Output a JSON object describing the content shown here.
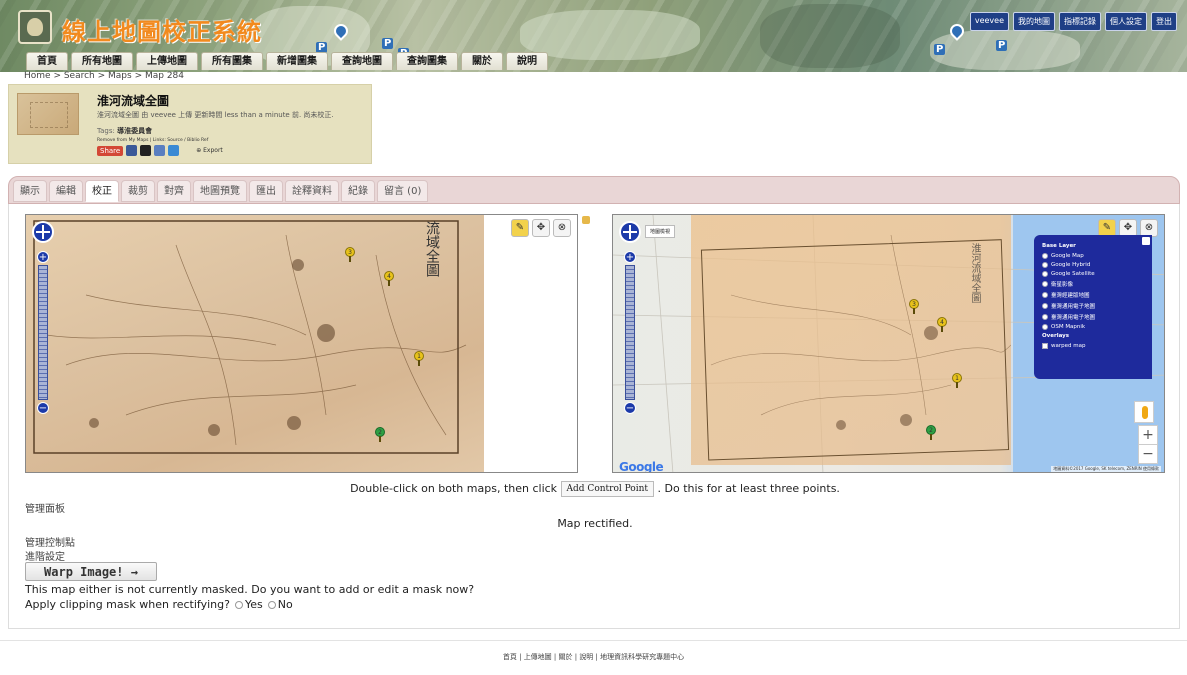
{
  "site": {
    "title": "線上地圖校正系統",
    "user_links": [
      "veevee",
      "我的地圖",
      "指標記錄",
      "個人設定",
      "登出"
    ]
  },
  "nav": {
    "items": [
      "首頁",
      "所有地圖",
      "上傳地圖",
      "所有圖集",
      "新增圖集",
      "查詢地圖",
      "查詢圖集",
      "關於",
      "說明"
    ]
  },
  "breadcrumb": "Home > Search > Maps > Map 284",
  "map_info": {
    "title": "淮河流域全圖",
    "description": "淮河流域全圖 由 veevee 上傳 更新時間 less than a minute 前. 尚未校正.",
    "tags_label": "Tags:",
    "tags": "導淮委員會",
    "links": "Remove from My Maps | Links: Source / Biblio Ref",
    "share_label": "Share",
    "export_label": "Export"
  },
  "tabs": [
    "顯示",
    "編輯",
    "校正",
    "裁剪",
    "對齊",
    "地圖預覽",
    "匯出",
    "詮釋資料",
    "紀錄",
    "留言 (0)"
  ],
  "active_tab": "校正",
  "left_map": {
    "vertical_title": "流域全圖",
    "control_points": [
      "3",
      "4",
      "1",
      "2"
    ]
  },
  "right_map": {
    "base_label": "地圖檢視",
    "vertical_title": "淮河流域全圖",
    "layer_switcher": {
      "base_layer_heading": "Base Layer",
      "base_layers": [
        "Google Map",
        "Google Hybrid",
        "Google Satellite",
        "衛星影像",
        "臺灣經建版地圖",
        "臺灣通用電子地圖",
        "臺灣通用電子地圖",
        "OSM Mapnik"
      ],
      "overlays_heading": "Overlays",
      "overlays": [
        "warped map"
      ]
    },
    "google_logo": "Google",
    "attribution": "地圖資料©2017 Google, SK telecom, ZENRIN  使用條款",
    "control_points": [
      "3",
      "4",
      "1",
      "2"
    ]
  },
  "tools": [
    "✎",
    "✥",
    "⊗"
  ],
  "instructions": {
    "before": "Double-click on both maps, then click",
    "button": "Add Control Point",
    "after": ". Do this for at least three points."
  },
  "admin_panel_label": "管理面板",
  "status": "Map rectified.",
  "manage_cp_label": "管理控制點",
  "advanced_label": "進階設定",
  "warp_button": "Warp Image! →",
  "mask_message": "This map either is not currently masked. Do you want to add or edit a mask now?",
  "clip": {
    "question": "Apply clipping mask when rectifying?",
    "yes": "Yes",
    "no": "No"
  },
  "footer": [
    "首頁",
    "上傳地圖",
    "關於",
    "說明",
    "地理資訊科學研究專題中心"
  ],
  "colors": {
    "title_orange": "#f28a1e",
    "user_link_bg": "#1f3f86",
    "layer_switcher_bg": "#1e2a9c",
    "tabbar_bg": "#e9d6d6",
    "info_bg": "#e6e1bf",
    "cp_yellow": "#e8c21a",
    "cp_green": "#2ea044"
  }
}
